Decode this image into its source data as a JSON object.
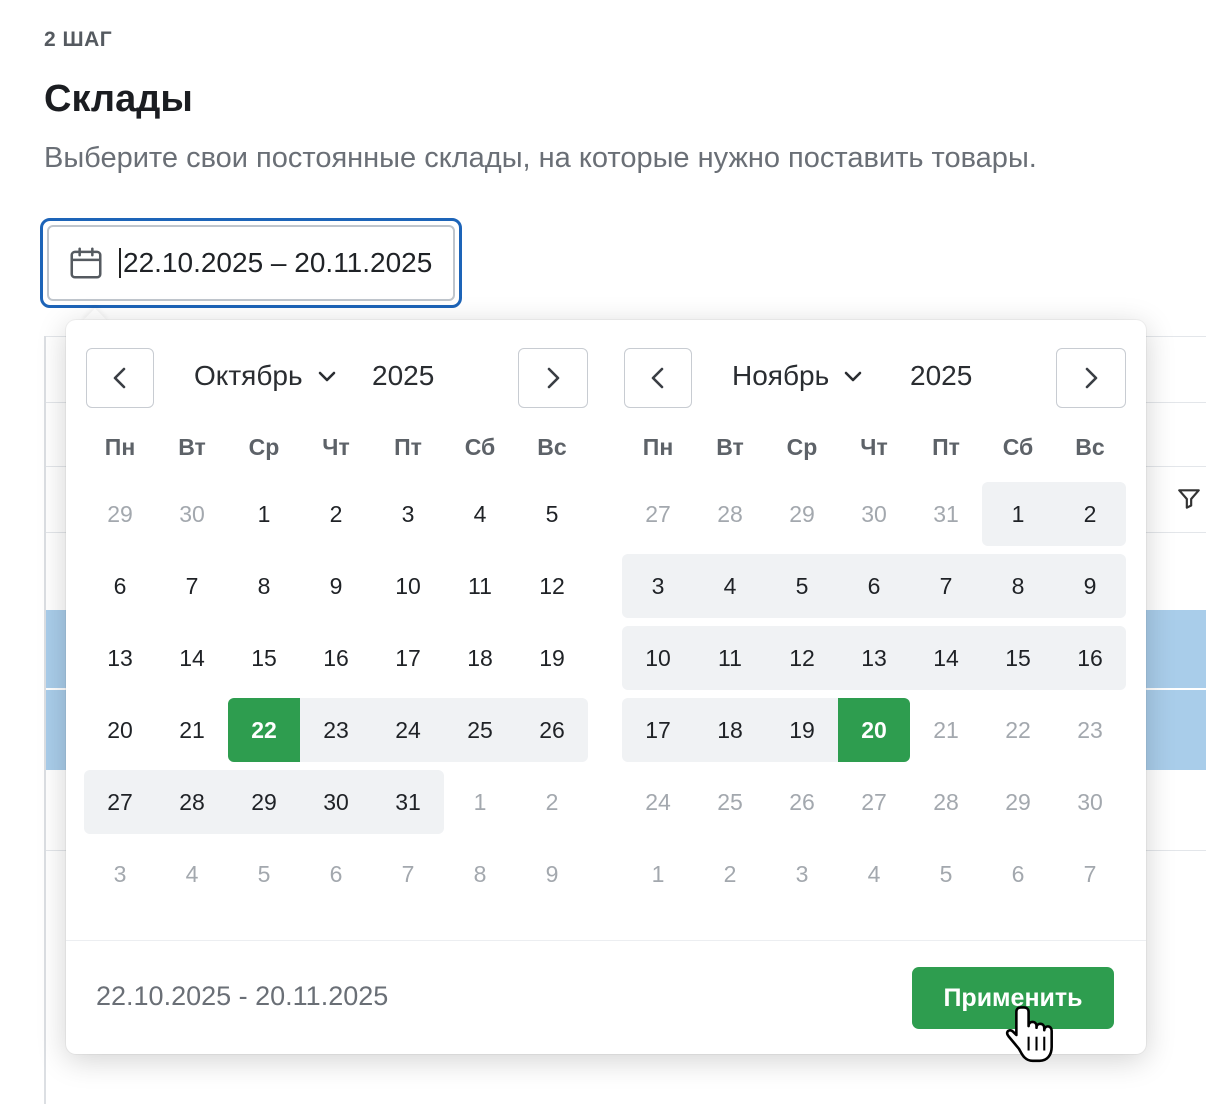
{
  "step": {
    "label": "2 ШАГ"
  },
  "page": {
    "title": "Склады",
    "subtitle": "Выберите свои постоянные склады, на которые нужно поставить товары."
  },
  "date_input": {
    "value": "22.10.2025 – 20.11.2025",
    "icon": "calendar-icon"
  },
  "calendar": {
    "weekdays": [
      "Пн",
      "Вт",
      "Ср",
      "Чт",
      "Пт",
      "Сб",
      "Вс"
    ],
    "left": {
      "month": "Октябрь",
      "year": "2025",
      "weeks": [
        [
          {
            "d": "29",
            "m": 1
          },
          {
            "d": "30",
            "m": 1
          },
          {
            "d": "1"
          },
          {
            "d": "2"
          },
          {
            "d": "3"
          },
          {
            "d": "4"
          },
          {
            "d": "5"
          }
        ],
        [
          {
            "d": "6"
          },
          {
            "d": "7"
          },
          {
            "d": "8"
          },
          {
            "d": "9"
          },
          {
            "d": "10"
          },
          {
            "d": "11"
          },
          {
            "d": "12"
          }
        ],
        [
          {
            "d": "13"
          },
          {
            "d": "14"
          },
          {
            "d": "15"
          },
          {
            "d": "16"
          },
          {
            "d": "17"
          },
          {
            "d": "18"
          },
          {
            "d": "19"
          }
        ],
        [
          {
            "d": "20"
          },
          {
            "d": "21"
          },
          {
            "d": "22",
            "s": 1
          },
          {
            "d": "23",
            "r": 1
          },
          {
            "d": "24",
            "r": 1
          },
          {
            "d": "25",
            "r": 1
          },
          {
            "d": "26",
            "r": 1
          }
        ],
        [
          {
            "d": "27",
            "r": 1
          },
          {
            "d": "28",
            "r": 1
          },
          {
            "d": "29",
            "r": 1
          },
          {
            "d": "30",
            "r": 1
          },
          {
            "d": "31",
            "r": 1
          },
          {
            "d": "1",
            "m": 1
          },
          {
            "d": "2",
            "m": 1
          }
        ],
        [
          {
            "d": "3",
            "m": 1
          },
          {
            "d": "4",
            "m": 1
          },
          {
            "d": "5",
            "m": 1
          },
          {
            "d": "6",
            "m": 1
          },
          {
            "d": "7",
            "m": 1
          },
          {
            "d": "8",
            "m": 1
          },
          {
            "d": "9",
            "m": 1
          }
        ]
      ]
    },
    "right": {
      "month": "Ноябрь",
      "year": "2025",
      "weeks": [
        [
          {
            "d": "27",
            "m": 1
          },
          {
            "d": "28",
            "m": 1
          },
          {
            "d": "29",
            "m": 1
          },
          {
            "d": "30",
            "m": 1
          },
          {
            "d": "31",
            "m": 1
          },
          {
            "d": "1",
            "r": 1
          },
          {
            "d": "2",
            "r": 1
          }
        ],
        [
          {
            "d": "3",
            "r": 1
          },
          {
            "d": "4",
            "r": 1
          },
          {
            "d": "5",
            "r": 1
          },
          {
            "d": "6",
            "r": 1
          },
          {
            "d": "7",
            "r": 1
          },
          {
            "d": "8",
            "r": 1
          },
          {
            "d": "9",
            "r": 1
          }
        ],
        [
          {
            "d": "10",
            "r": 1
          },
          {
            "d": "11",
            "r": 1
          },
          {
            "d": "12",
            "r": 1
          },
          {
            "d": "13",
            "r": 1
          },
          {
            "d": "14",
            "r": 1
          },
          {
            "d": "15",
            "r": 1
          },
          {
            "d": "16",
            "r": 1
          }
        ],
        [
          {
            "d": "17",
            "r": 1
          },
          {
            "d": "18",
            "r": 1
          },
          {
            "d": "19",
            "r": 1
          },
          {
            "d": "20",
            "s": 1
          },
          {
            "d": "21",
            "m": 1
          },
          {
            "d": "22",
            "m": 1
          },
          {
            "d": "23",
            "m": 1
          }
        ],
        [
          {
            "d": "24",
            "m": 1
          },
          {
            "d": "25",
            "m": 1
          },
          {
            "d": "26",
            "m": 1
          },
          {
            "d": "27",
            "m": 1
          },
          {
            "d": "28",
            "m": 1
          },
          {
            "d": "29",
            "m": 1
          },
          {
            "d": "30",
            "m": 1
          }
        ],
        [
          {
            "d": "1",
            "m": 1
          },
          {
            "d": "2",
            "m": 1
          },
          {
            "d": "3",
            "m": 1
          },
          {
            "d": "4",
            "m": 1
          },
          {
            "d": "5",
            "m": 1
          },
          {
            "d": "6",
            "m": 1
          },
          {
            "d": "7",
            "m": 1
          }
        ]
      ]
    },
    "footer_range": "22.10.2025 - 20.11.2025",
    "apply_label": "Применить"
  },
  "colors": {
    "accent_green": "#2e9d4f",
    "focus_blue": "#1d64b8",
    "range_bg": "#f0f2f4",
    "row_highlight": "#a9cdea"
  }
}
